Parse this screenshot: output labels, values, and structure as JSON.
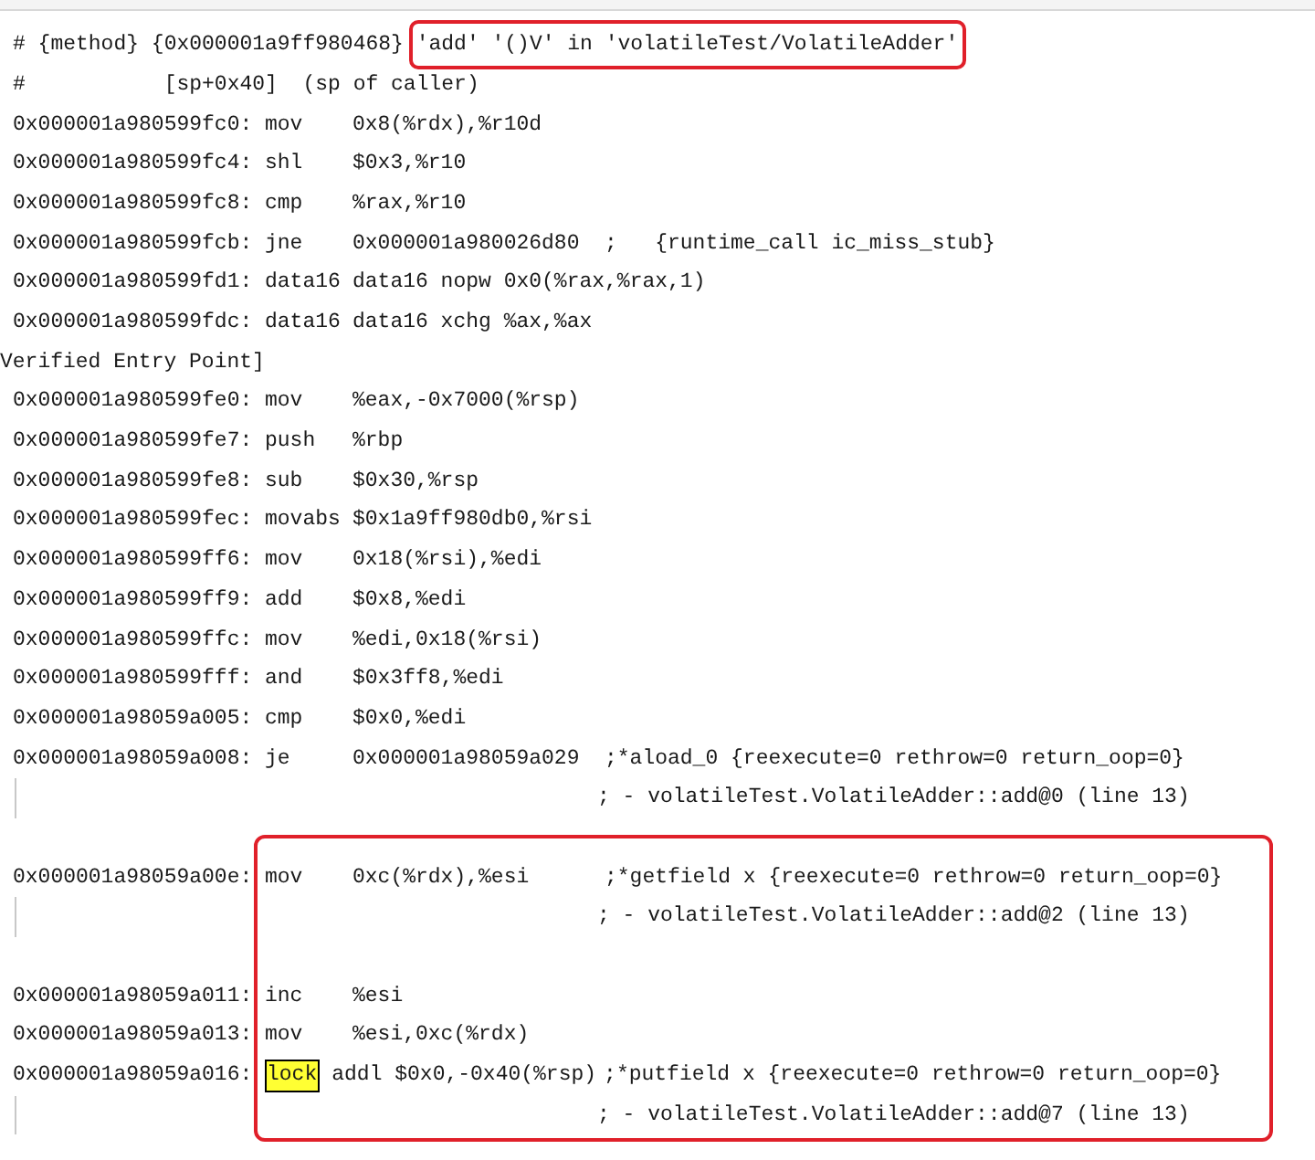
{
  "sections": [
    {
      "rows": [
        {
          "kind": "boxed_header",
          "text": "# {method} {0x000001a9ff980468} ",
          "boxed": "'add' '()V' in 'volatileTest/VolatileAdder'"
        },
        {
          "kind": "text",
          "text": "#           [sp+0x40]  (sp of caller)"
        },
        {
          "kind": "instr",
          "address": "0x000001a980599fc0:",
          "op": "mov",
          "args": "0x8(%rdx),%r10d"
        },
        {
          "kind": "instr",
          "address": "0x000001a980599fc4:",
          "op": "shl",
          "args": "$0x3,%r10"
        },
        {
          "kind": "instr",
          "address": "0x000001a980599fc8:",
          "op": "cmp",
          "args": "%rax,%r10"
        },
        {
          "kind": "instr",
          "address": "0x000001a980599fcb:",
          "op": "jne",
          "args": "0x000001a980026d80",
          "comment": ";   {runtime_call ic_miss_stub}"
        },
        {
          "kind": "instr",
          "address": "0x000001a980599fd1:",
          "op": "data16",
          "args": "data16 nopw 0x0(%rax,%rax,1)"
        },
        {
          "kind": "instr",
          "address": "0x000001a980599fdc:",
          "op": "data16",
          "args": "data16 xchg %ax,%ax"
        },
        {
          "kind": "label",
          "text": "Verified Entry Point]"
        },
        {
          "kind": "instr",
          "address": "0x000001a980599fe0:",
          "op": "mov",
          "args": "%eax,-0x7000(%rsp)"
        },
        {
          "kind": "instr",
          "address": "0x000001a980599fe7:",
          "op": "push",
          "args": "%rbp"
        },
        {
          "kind": "instr",
          "address": "0x000001a980599fe8:",
          "op": "sub",
          "args": "$0x30,%rsp"
        },
        {
          "kind": "instr",
          "address": "0x000001a980599fec:",
          "op": "movabs",
          "args": "$0x1a9ff980db0,%rsi"
        },
        {
          "kind": "instr",
          "address": "0x000001a980599ff6:",
          "op": "mov",
          "args": "0x18(%rsi),%edi"
        },
        {
          "kind": "instr",
          "address": "0x000001a980599ff9:",
          "op": "add",
          "args": "$0x8,%edi"
        },
        {
          "kind": "instr",
          "address": "0x000001a980599ffc:",
          "op": "mov",
          "args": "%edi,0x18(%rsi)"
        },
        {
          "kind": "instr",
          "address": "0x000001a980599fff:",
          "op": "and",
          "args": "$0x3ff8,%edi"
        },
        {
          "kind": "instr",
          "address": "0x000001a98059a005:",
          "op": "cmp",
          "args": "$0x0,%edi"
        },
        {
          "kind": "instr",
          "address": "0x000001a98059a008:",
          "op": "je",
          "args": "0x000001a98059a029",
          "comment": ";*aload_0 {reexecute=0 rethrow=0 return_oop=0}"
        },
        {
          "kind": "continuation",
          "comment": "; - volatileTest.VolatileAdder::add@0 (line 13)"
        }
      ]
    },
    {
      "outlined": true,
      "rows": [
        {
          "kind": "blank"
        },
        {
          "kind": "instr",
          "address": "0x000001a98059a00e:",
          "op": "mov",
          "args": "0xc(%rdx),%esi",
          "comment": ";*getfield x {reexecute=0 rethrow=0 return_oop=0}"
        },
        {
          "kind": "continuation",
          "comment": "; - volatileTest.VolatileAdder::add@2 (line 13)"
        },
        {
          "kind": "blank"
        },
        {
          "kind": "instr",
          "address": "0x000001a98059a011:",
          "op": "inc",
          "args": "%esi"
        },
        {
          "kind": "instr",
          "address": "0x000001a98059a013:",
          "op": "mov",
          "args": "%esi,0xc(%rdx)"
        },
        {
          "kind": "instr",
          "address": "0x000001a98059a016:",
          "op": "lock",
          "highlighted": true,
          "args": "addl $0x0,-0x40(%rsp)",
          "comment": ";*putfield x {reexecute=0 rethrow=0 return_oop=0}"
        },
        {
          "kind": "continuation",
          "comment": "; - volatileTest.VolatileAdder::add@7 (line 13)"
        }
      ]
    }
  ]
}
